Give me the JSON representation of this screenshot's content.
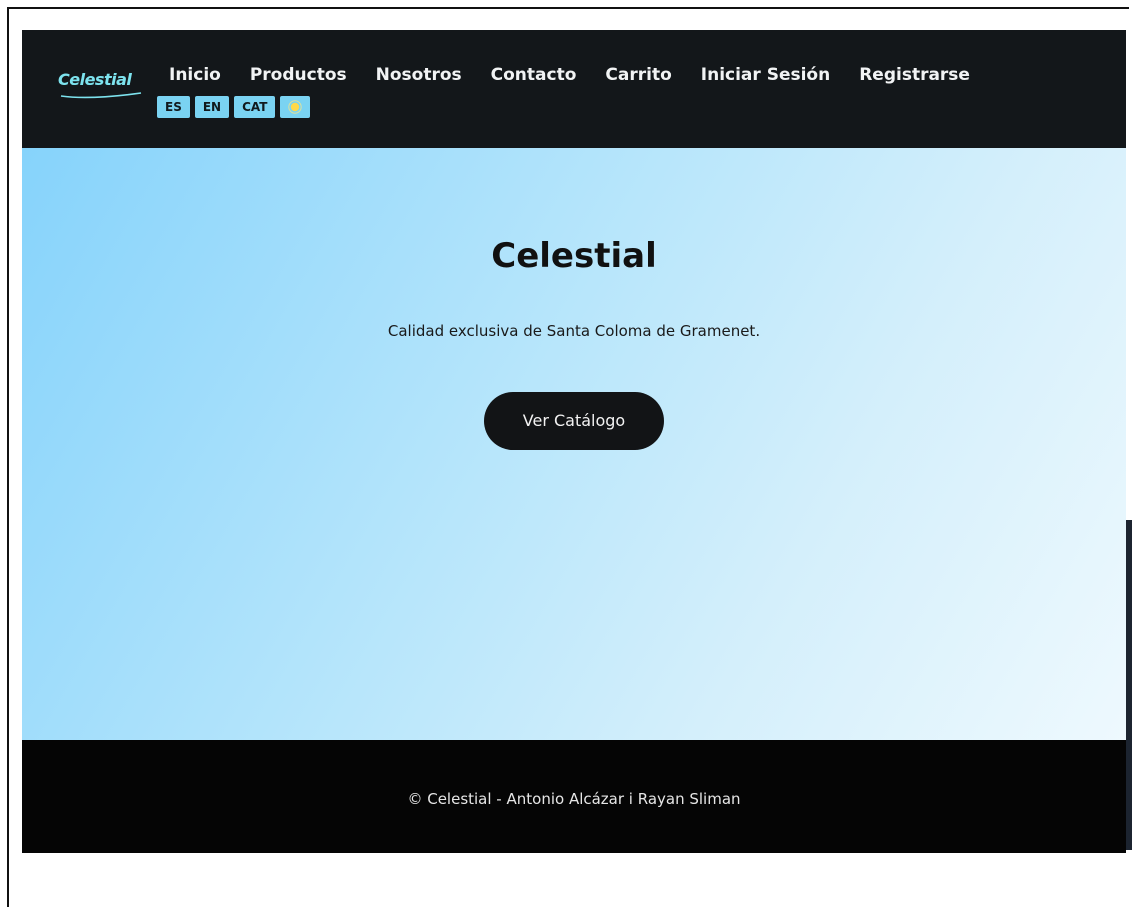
{
  "brand": {
    "logo_text": "Celestial",
    "colors": {
      "navbar_bg": "#13171a",
      "accent": "#7ad3f2",
      "hero_gradient_start": "#86d3fb",
      "hero_gradient_end": "#eef9fe",
      "button_bg": "#121416",
      "footer_bg": "#050505"
    }
  },
  "nav": {
    "items": [
      {
        "label": "Inicio"
      },
      {
        "label": "Productos"
      },
      {
        "label": "Nosotros"
      },
      {
        "label": "Contacto"
      },
      {
        "label": "Carrito"
      },
      {
        "label": "Iniciar Sesión"
      },
      {
        "label": "Registrarse"
      }
    ],
    "languages": [
      "ES",
      "EN",
      "CAT"
    ],
    "theme_toggle_icon": "sun-icon"
  },
  "hero": {
    "title": "Celestial",
    "subtitle": "Calidad exclusiva de Santa Coloma de Gramenet.",
    "cta_label": "Ver Catálogo"
  },
  "footer": {
    "text": "© Celestial - Antonio Alcázar i Rayan Sliman"
  }
}
